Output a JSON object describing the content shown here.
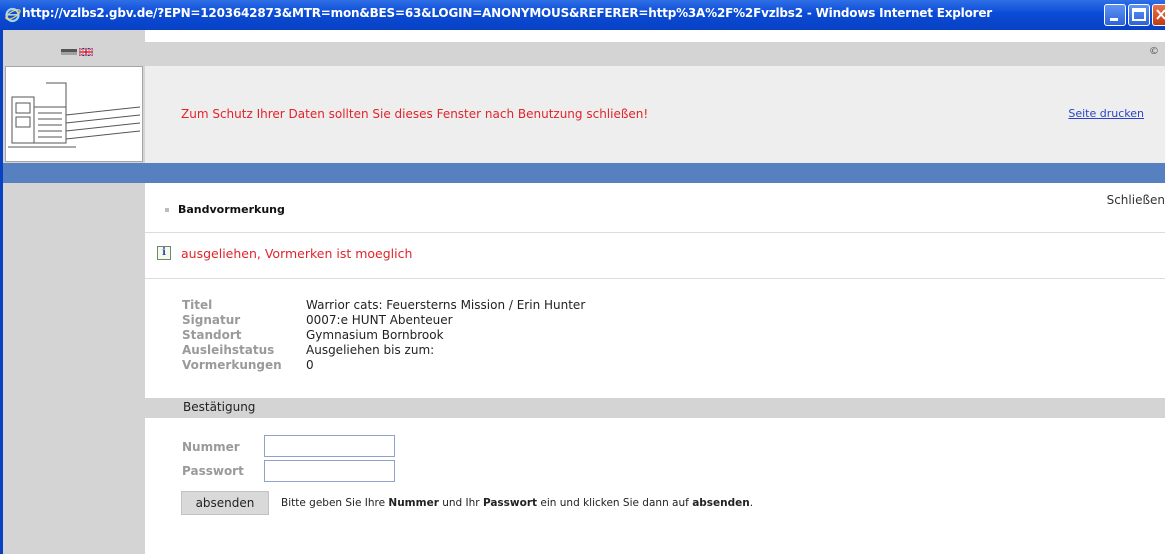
{
  "window": {
    "title": "http://vzlbs2.gbv.de/?EPN=1203642873&MTR=mon&BES=63&LOGIN=ANONYMOUS&REFERER=http%3A%2F%2Fvzlbs2 - Windows Internet Explorer"
  },
  "header": {
    "copyright": "©",
    "warning": "Zum Schutz Ihrer Daten sollten Sie dieses Fenster nach Benutzung schließen!",
    "print_link": "Seite drucken"
  },
  "sidebar": {
    "close_link": "Schließen"
  },
  "section": {
    "title": "Bandvormerkung",
    "status": "ausgeliehen, Vormerken ist moeglich",
    "info_icon": "i"
  },
  "details": {
    "rows": [
      {
        "label": "Titel",
        "value": "Warrior cats: Feuersterns Mission / Erin Hunter"
      },
      {
        "label": "Signatur",
        "value": "0007:e HUNT Abenteuer"
      },
      {
        "label": "Standort",
        "value": "Gymnasium Bornbrook"
      },
      {
        "label": "Ausleihstatus",
        "value": "Ausgeliehen bis zum:"
      },
      {
        "label": "Vormerkungen",
        "value": "0"
      }
    ]
  },
  "confirm": {
    "heading": "Bestätigung",
    "number_label": "Nummer",
    "number_value": "",
    "password_label": "Passwort",
    "password_value": "",
    "submit_label": "absenden",
    "hint_prefix": "Bitte geben Sie Ihre ",
    "hint_number": "Nummer",
    "hint_mid": " und Ihr ",
    "hint_password": "Passwort",
    "hint_mid2": " ein und klicken Sie dann auf ",
    "hint_submit": "absenden",
    "hint_suffix": "."
  },
  "colors": {
    "title_bar": "#0a4bd6",
    "accent_blue": "#5680c0",
    "warning_red": "#e2232a",
    "link_blue": "#2a44c4",
    "sidebar_gray": "#d4d4d4",
    "header_gray": "#eeeeee"
  },
  "icons": {
    "browser": "internet-explorer-icon",
    "flag_de": "flag-de-icon",
    "flag_uk": "flag-uk-icon",
    "logo": "library-building-logo",
    "info": "info-icon"
  }
}
